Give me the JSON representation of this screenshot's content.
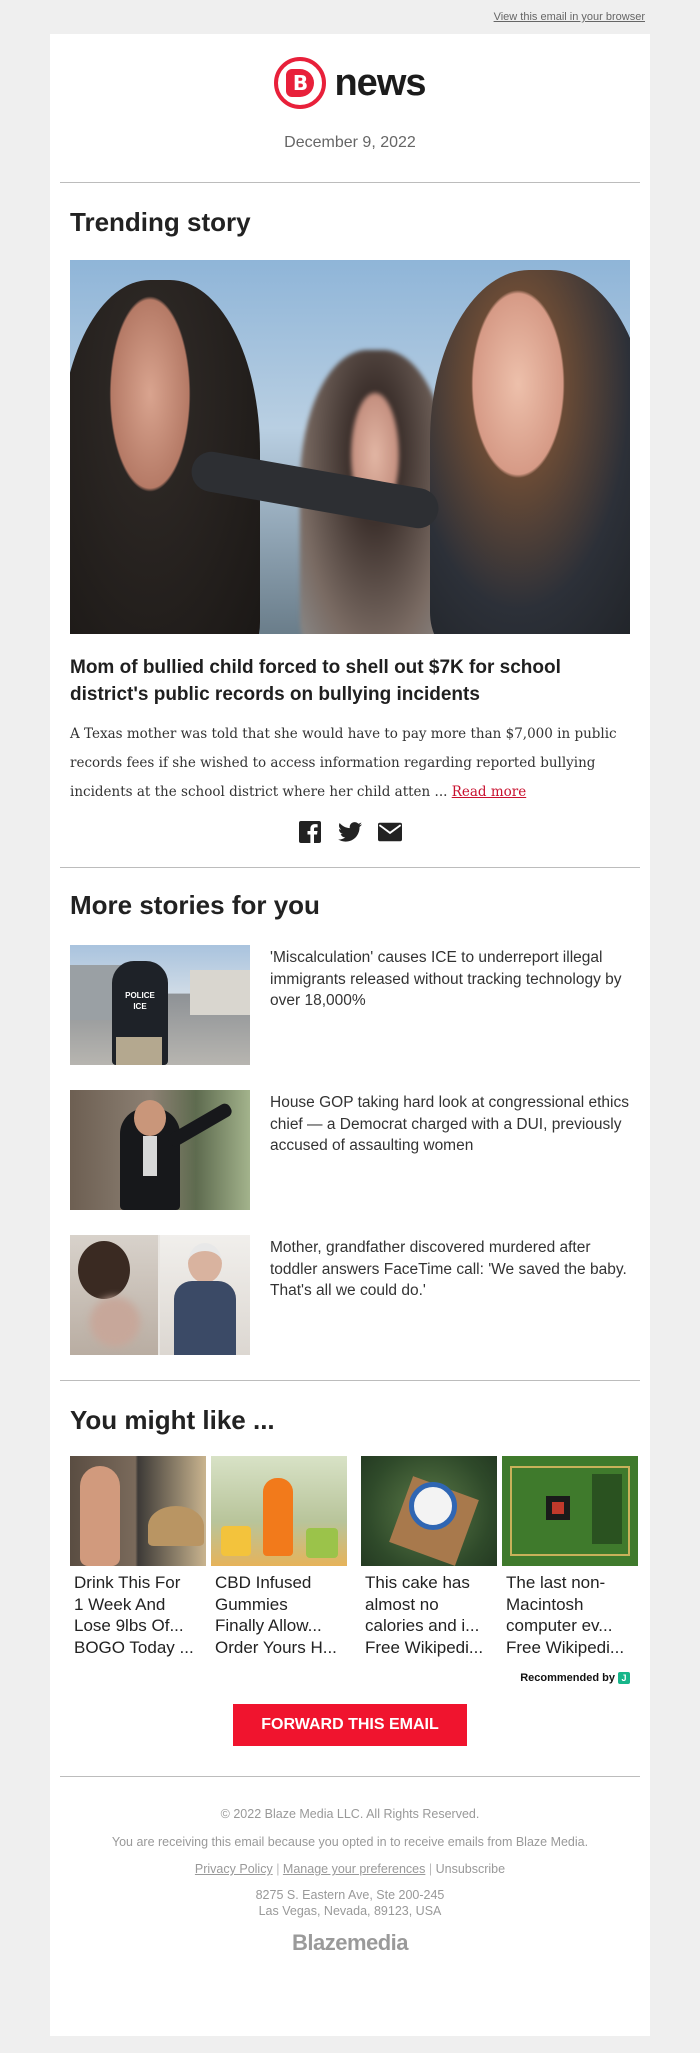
{
  "topbar": {
    "view_in_browser": "View this email in your browser"
  },
  "brand": {
    "logo_glyph": "B",
    "wordmark": "news",
    "accent": "#e8203a"
  },
  "date": "December 9, 2022",
  "trending": {
    "heading": "Trending story",
    "title": "Mom of bullied child forced to shell out $7K for school district's public records on bullying incidents",
    "body": "A Texas mother was told that she would have to pay more than $7,000 in public records fees if she wished to access information regarding reported bullying incidents at the school district where her child atten ... ",
    "read_more": "Read more",
    "share_icons": [
      "facebook-icon",
      "twitter-icon",
      "email-icon"
    ]
  },
  "more": {
    "heading": "More stories for you",
    "stories": [
      {
        "title": "'Miscalculation' causes ICE to underreport illegal immigrants released without tracking technology by over 18,000%",
        "thumb_text": "POLICE ICE"
      },
      {
        "title": "House GOP taking hard look at congressional ethics chief — a Democrat charged with a DUI, previously accused of assaulting women"
      },
      {
        "title": "Mother, grandfather discovered murdered after toddler answers FaceTime call: 'We saved the baby. That's all we could do.'"
      }
    ]
  },
  "like": {
    "heading": "You might like ...",
    "items": [
      {
        "line1": "Drink This For",
        "line2": "1 Week And",
        "line3": "Lose 9lbs Of...",
        "line4": "BOGO Today ..."
      },
      {
        "line1": "CBD Infused",
        "line2": "Gummies",
        "line3": "Finally Allow...",
        "line4": "Order Yours H..."
      },
      {
        "line1": "This cake has",
        "line2": "almost no",
        "line3": "calories and i...",
        "line4": "Free Wikipedi..."
      },
      {
        "line1": "The last non-",
        "line2": "Macintosh",
        "line3": "computer ev...",
        "line4": "Free Wikipedi..."
      }
    ],
    "recommended_by": "Recommended by",
    "rec_badge": "J"
  },
  "forward_button": "FORWARD THIS EMAIL",
  "footer": {
    "copyright": "© 2022 Blaze Media LLC. All Rights Reserved.",
    "optin": "You are receiving this email because you opted in to receive emails from Blaze Media.",
    "privacy": "Privacy Policy",
    "preferences": "Manage your preferences",
    "unsubscribe": "Unsubscribe",
    "separator": "|",
    "address1": "8275 S. Eastern Ave, Ste 200-245",
    "address2": "Las Vegas, Nevada, 89123, USA",
    "logo": "Blazemedia"
  }
}
